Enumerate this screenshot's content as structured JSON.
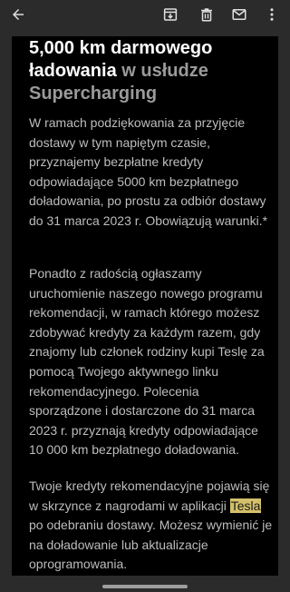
{
  "toolbar": {
    "icons": [
      "arrow-back-icon",
      "archive-icon",
      "delete-icon",
      "mail-icon",
      "more-vert-icon"
    ]
  },
  "email": {
    "heading": {
      "part1": "5,000 km ",
      "part2": "darmowego ładowania",
      "part3": " w usłudze Supercharging"
    },
    "paragraph1": "W ramach podziękowania za przyjęcie dostawy w tym napiętym czasie, przyznajemy bezpłatne kredyty odpowiadające 5000 km bezpłatnego doładowania, po prostu za odbiór dostawy do 31 marca 2023 r. Obowiązują warunki.*",
    "paragraph2": "Ponadto z radością ogłaszamy uruchomienie naszego nowego programu rekomendacji, w ramach którego możesz zdobywać kredyty za każdym razem, gdy znajomy lub członek rodziny kupi Teslę za pomocą Twojego aktywnego linku rekomendacyjnego. Polecenia sporządzone i dostarczone do 31 marca 2023 r. przyznają kredyty odpowiadające 10 000 km bezpłatnego doładowania.",
    "paragraph3": {
      "before": "Twoje kredyty rekomendacyjne pojawią się w skrzynce z nagrodami w aplikacji ",
      "highlight": "Tesla",
      "after": " po odebraniu dostawy. Możesz wymienić je na doładowanie lub aktualizacje oprogramowania."
    }
  },
  "colors": {
    "background": "#2b2b2b",
    "panel": "#000000",
    "heading_white": "#ffffff",
    "heading_gray": "#9a9a9a",
    "body_text": "#bdbdbd",
    "highlight": "#d4c06a"
  }
}
